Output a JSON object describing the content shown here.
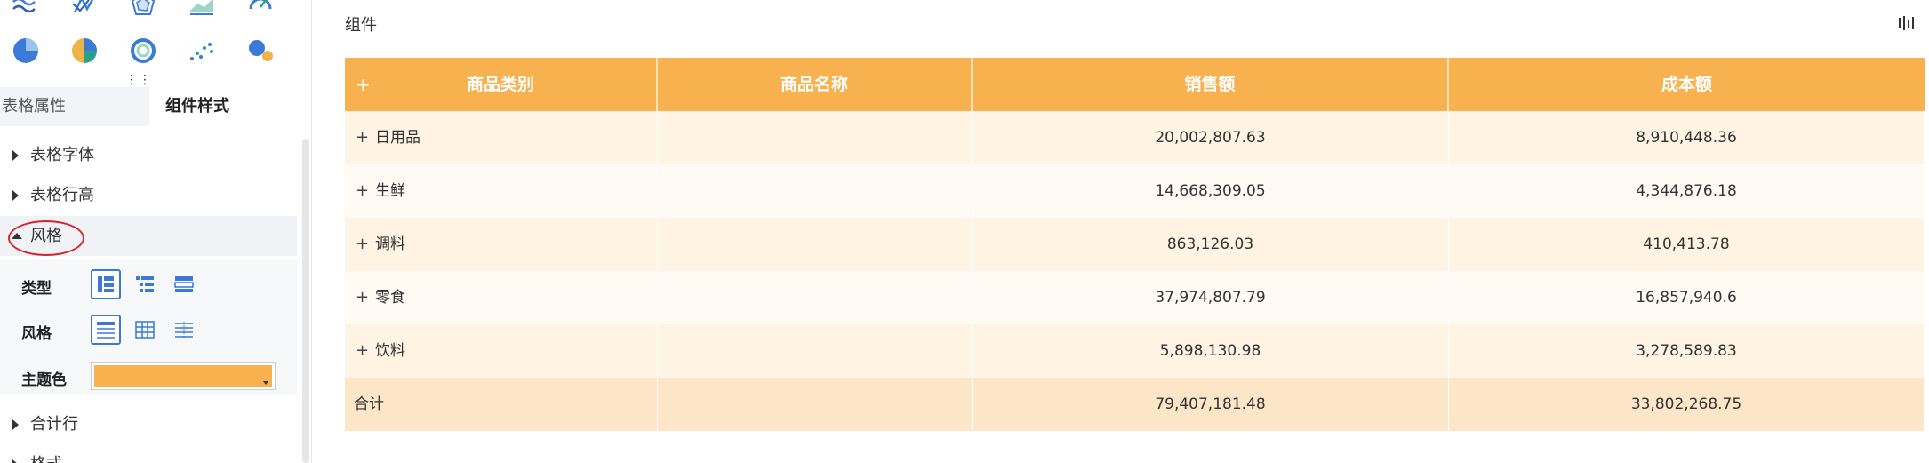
{
  "left_panel": {
    "chart_icons_row1": [
      "line-chart-icon",
      "scatter-line-icon",
      "radar-chart-icon",
      "area-chart-icon",
      "gauge-chart-icon"
    ],
    "chart_icons_row2": [
      "pie-chart-icon",
      "multi-pie-chart-icon",
      "donut-chart-icon",
      "scatter-chart-icon",
      "bubble-chart-icon"
    ],
    "drag_handle": "⋮⋮",
    "tabs": [
      {
        "label": "表格属性",
        "active": false
      },
      {
        "label": "组件样式",
        "active": true
      }
    ],
    "sections": {
      "font": "表格字体",
      "row_height": "表格行高",
      "style": "风格",
      "total_row": "合计行",
      "format": "格式"
    },
    "style_panel": {
      "type_label": "类型",
      "style_label": "风格",
      "theme_label": "主题色",
      "theme_color": "#f8b14f"
    }
  },
  "main": {
    "title": "组件",
    "table": {
      "headers": [
        "商品类别",
        "商品名称",
        "销售额",
        "成本额"
      ],
      "header_expand": "+",
      "rows": [
        {
          "expand": "+",
          "category": "日用品",
          "name": "",
          "sales": "20,002,807.63",
          "cost": "8,910,448.36"
        },
        {
          "expand": "+",
          "category": "生鲜",
          "name": "",
          "sales": "14,668,309.05",
          "cost": "4,344,876.18"
        },
        {
          "expand": "+",
          "category": "调料",
          "name": "",
          "sales": "863,126.03",
          "cost": "410,413.78"
        },
        {
          "expand": "+",
          "category": "零食",
          "name": "",
          "sales": "37,974,807.79",
          "cost": "16,857,940.6"
        },
        {
          "expand": "+",
          "category": "饮料",
          "name": "",
          "sales": "5,898,130.98",
          "cost": "3,278,589.83"
        }
      ],
      "total": {
        "label": "合计",
        "sales": "79,407,181.48",
        "cost": "33,802,268.75"
      }
    }
  },
  "colors": {
    "header_bg": "#f8b14f",
    "row_odd": "#fff3e3",
    "row_even": "#fffaf3",
    "total_bg": "#fde6c7",
    "active_blue": "#3b78d8",
    "annotation_red": "#d9232e"
  }
}
